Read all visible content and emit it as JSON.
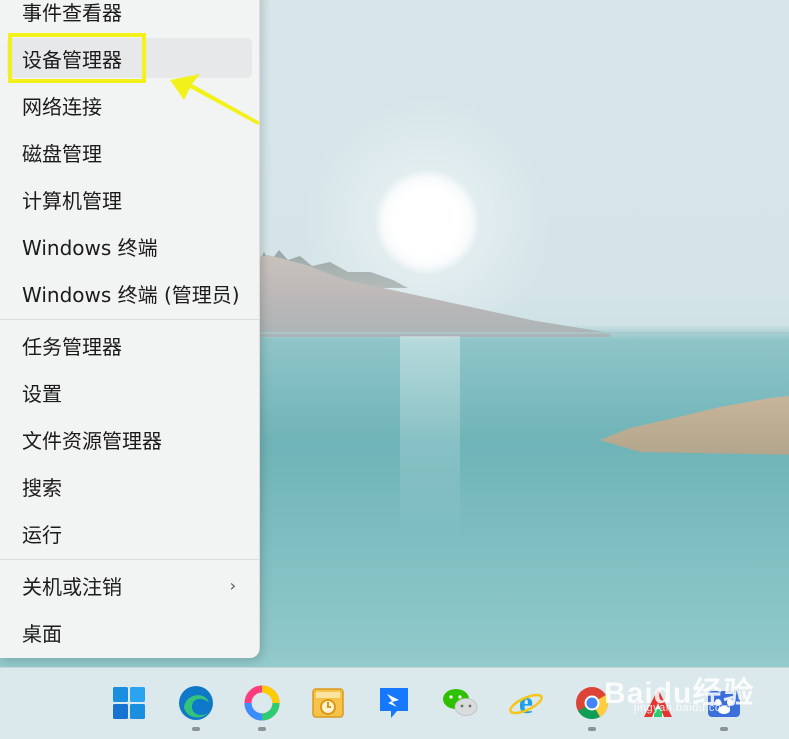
{
  "menu": {
    "items": [
      {
        "label": "事件查看器"
      },
      {
        "label": "设备管理器"
      },
      {
        "label": "网络连接"
      },
      {
        "label": "磁盘管理"
      },
      {
        "label": "计算机管理"
      },
      {
        "label": "Windows 终端"
      },
      {
        "label": "Windows 终端 (管理员)"
      },
      {
        "label": "任务管理器"
      },
      {
        "label": "设置"
      },
      {
        "label": "文件资源管理器"
      },
      {
        "label": "搜索"
      },
      {
        "label": "运行"
      },
      {
        "label": "关机或注销"
      },
      {
        "label": "桌面"
      }
    ]
  },
  "annotation": {
    "color": "#f2f21a"
  },
  "taskbar": {
    "icons": [
      "windows-start-icon",
      "edge-icon",
      "colorful-ring-app-icon",
      "outlook-icon",
      "dingtalk-icon",
      "wechat-icon",
      "internet-explorer-icon",
      "chrome-icon",
      "red-app-icon",
      "baidu-paw-icon"
    ]
  },
  "watermark": {
    "main": "Baidu经验",
    "sub": "jingyan.baidu.com"
  }
}
